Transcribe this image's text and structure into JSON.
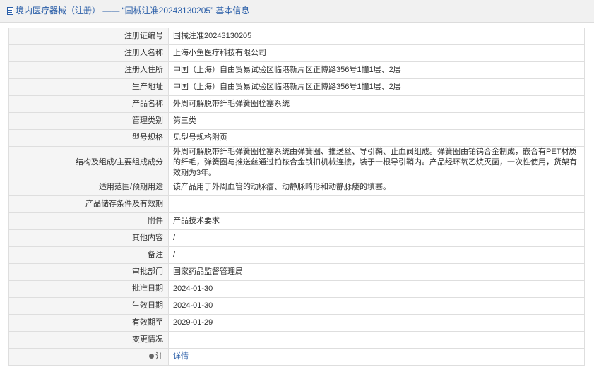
{
  "header": {
    "title": "境内医疗器械（注册） —— “国械注准20243130205” 基本信息"
  },
  "rows": [
    {
      "label": "注册证编号",
      "value": "国械注准20243130205"
    },
    {
      "label": "注册人名称",
      "value": "上海小鱼医疗科技有限公司"
    },
    {
      "label": "注册人住所",
      "value": "中国（上海）自由贸易试验区临港新片区正博路356号1幢1层、2层"
    },
    {
      "label": "生产地址",
      "value": "中国（上海）自由贸易试验区临港新片区正博路356号1幢1层、2层"
    },
    {
      "label": "产品名称",
      "value": "外周可解脱带纤毛弹簧圈栓塞系统"
    },
    {
      "label": "管理类别",
      "value": "第三类"
    },
    {
      "label": "型号规格",
      "value": "见型号规格附页"
    },
    {
      "label": "结构及组成/主要组成成分",
      "value": "外周可解脱带纤毛弹簧圈栓塞系统由弹簧圈、推送丝、导引鞘、止血阀组成。弹簧圈由铂钨合金制成，嵌合有PET材质的纤毛，弹簧圈与推送丝通过铂铱合金锁扣机械连接，装于一根导引鞘内。产品经环氧乙烷灭菌，一次性使用，货架有效期为3年。"
    },
    {
      "label": "适用范围/预期用途",
      "value": "该产品用于外周血管的动脉瘤、动静脉畸形和动静脉瘘的填塞。"
    },
    {
      "label": "产品储存条件及有效期",
      "value": ""
    },
    {
      "label": "附件",
      "value": "产品技术要求"
    },
    {
      "label": "其他内容",
      "value": "/"
    },
    {
      "label": "备注",
      "value": "/"
    },
    {
      "label": "审批部门",
      "value": "国家药品监督管理局"
    },
    {
      "label": "批准日期",
      "value": "2024-01-30"
    },
    {
      "label": "生效日期",
      "value": "2024-01-30"
    },
    {
      "label": "有效期至",
      "value": "2029-01-29"
    },
    {
      "label": "变更情况",
      "value": ""
    }
  ],
  "note_row": {
    "label": "注",
    "link": "详情"
  }
}
